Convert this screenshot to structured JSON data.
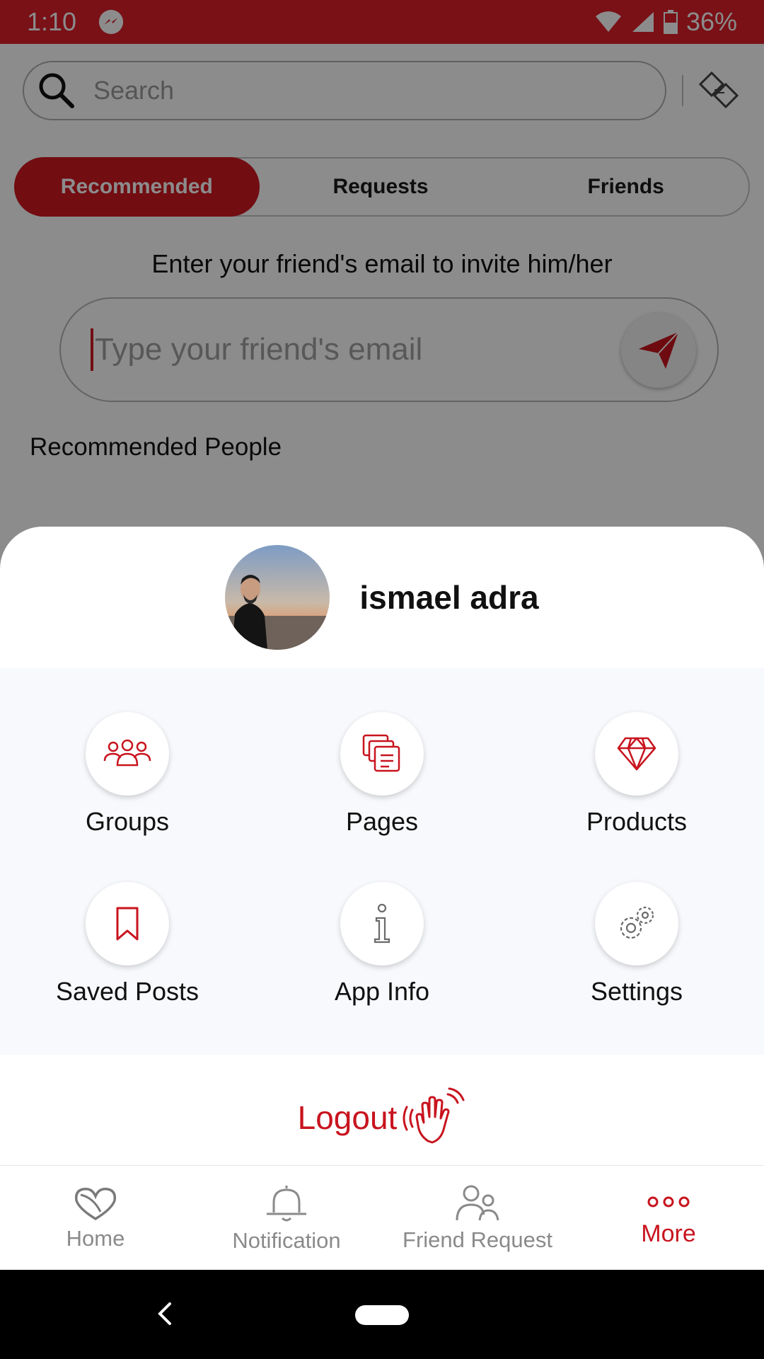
{
  "status_bar": {
    "time": "1:10",
    "battery": "36%"
  },
  "search": {
    "placeholder": "Search"
  },
  "tabs": [
    {
      "label": "Recommended",
      "active": true
    },
    {
      "label": "Requests",
      "active": false
    },
    {
      "label": "Friends",
      "active": false
    }
  ],
  "invite": {
    "label": "Enter your friend's email to invite him/her",
    "placeholder": "Type your friend's email"
  },
  "recommended_people_label": "Recommended People",
  "sheet": {
    "profile_name": "ismael adra",
    "items": [
      {
        "label": "Groups",
        "icon": "groups-icon"
      },
      {
        "label": "Pages",
        "icon": "pages-icon"
      },
      {
        "label": "Products",
        "icon": "diamond-icon"
      },
      {
        "label": "Saved Posts",
        "icon": "bookmark-icon"
      },
      {
        "label": "App Info",
        "icon": "info-icon"
      },
      {
        "label": "Settings",
        "icon": "gear-icon"
      }
    ],
    "logout_label": "Logout"
  },
  "bottom_nav": [
    {
      "label": "Home",
      "icon": "home-icon",
      "active": false
    },
    {
      "label": "Notification",
      "icon": "bell-icon",
      "active": false
    },
    {
      "label": "Friend Request",
      "icon": "friends-icon",
      "active": false
    },
    {
      "label": "More",
      "icon": "more-icon",
      "active": true
    }
  ],
  "colors": {
    "accent": "#d01821",
    "status_bar": "#dc1f2b",
    "inactive": "#8a8a8a"
  }
}
